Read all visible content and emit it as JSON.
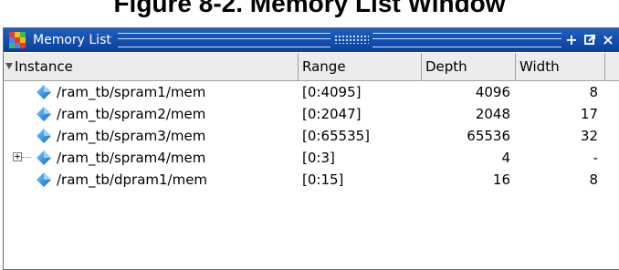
{
  "caption": "Figure 8-2. Memory List Window",
  "window": {
    "title": "Memory List",
    "buttons": [
      {
        "name": "dock-button",
        "glyph": "+"
      },
      {
        "name": "undock-button",
        "glyph": ""
      },
      {
        "name": "close-button",
        "glyph": "×"
      }
    ]
  },
  "columns": [
    "Instance",
    "Range",
    "Depth",
    "Width"
  ],
  "rows": [
    {
      "instance": "/ram_tb/spram1/mem",
      "range": "[0:4095]",
      "depth": "4096",
      "width": "8",
      "expandable": false
    },
    {
      "instance": "/ram_tb/spram2/mem",
      "range": "[0:2047]",
      "depth": "2048",
      "width": "17",
      "expandable": false
    },
    {
      "instance": "/ram_tb/spram3/mem",
      "range": "[0:65535]",
      "depth": "65536",
      "width": "32",
      "expandable": false
    },
    {
      "instance": "/ram_tb/spram4/mem",
      "range": "[0:3]",
      "depth": "4",
      "width": "-",
      "expandable": true
    },
    {
      "instance": "/ram_tb/dpram1/mem",
      "range": "[0:15]",
      "depth": "16",
      "width": "8",
      "expandable": false
    }
  ],
  "expander_glyph": "+",
  "colors": {
    "titlebar": "#1f5fbf",
    "header": "#ececec",
    "memory_icon": "#1e90ff"
  }
}
